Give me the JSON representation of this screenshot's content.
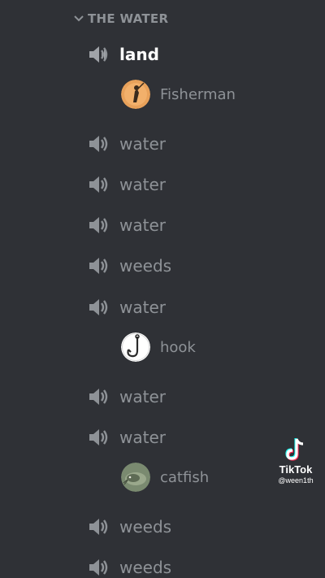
{
  "category": {
    "label": "THE WATER",
    "icon": "chevron-down-icon"
  },
  "colors": {
    "background": "#2f3136",
    "muted_text": "#8e9297",
    "active_text": "#ffffff"
  },
  "channels": [
    {
      "label": "land",
      "active": true,
      "icon": "speaker-icon"
    },
    {
      "label": "water",
      "icon": "speaker-icon"
    },
    {
      "label": "water",
      "icon": "speaker-icon"
    },
    {
      "label": "water",
      "icon": "speaker-icon"
    },
    {
      "label": "weeds",
      "icon": "speaker-icon"
    },
    {
      "label": "water",
      "icon": "speaker-icon"
    },
    {
      "label": "water",
      "icon": "speaker-icon"
    },
    {
      "label": "water",
      "icon": "speaker-icon"
    },
    {
      "label": "weeds",
      "icon": "speaker-icon"
    },
    {
      "label": "weeds",
      "icon": "speaker-icon"
    }
  ],
  "voice_users": [
    {
      "name": "Fisherman",
      "channel_index": 0
    },
    {
      "name": "hook",
      "channel_index": 5
    },
    {
      "name": "catfish",
      "channel_index": 7
    }
  ],
  "watermark": {
    "brand": "TikTok",
    "handle": "@ween1th"
  }
}
